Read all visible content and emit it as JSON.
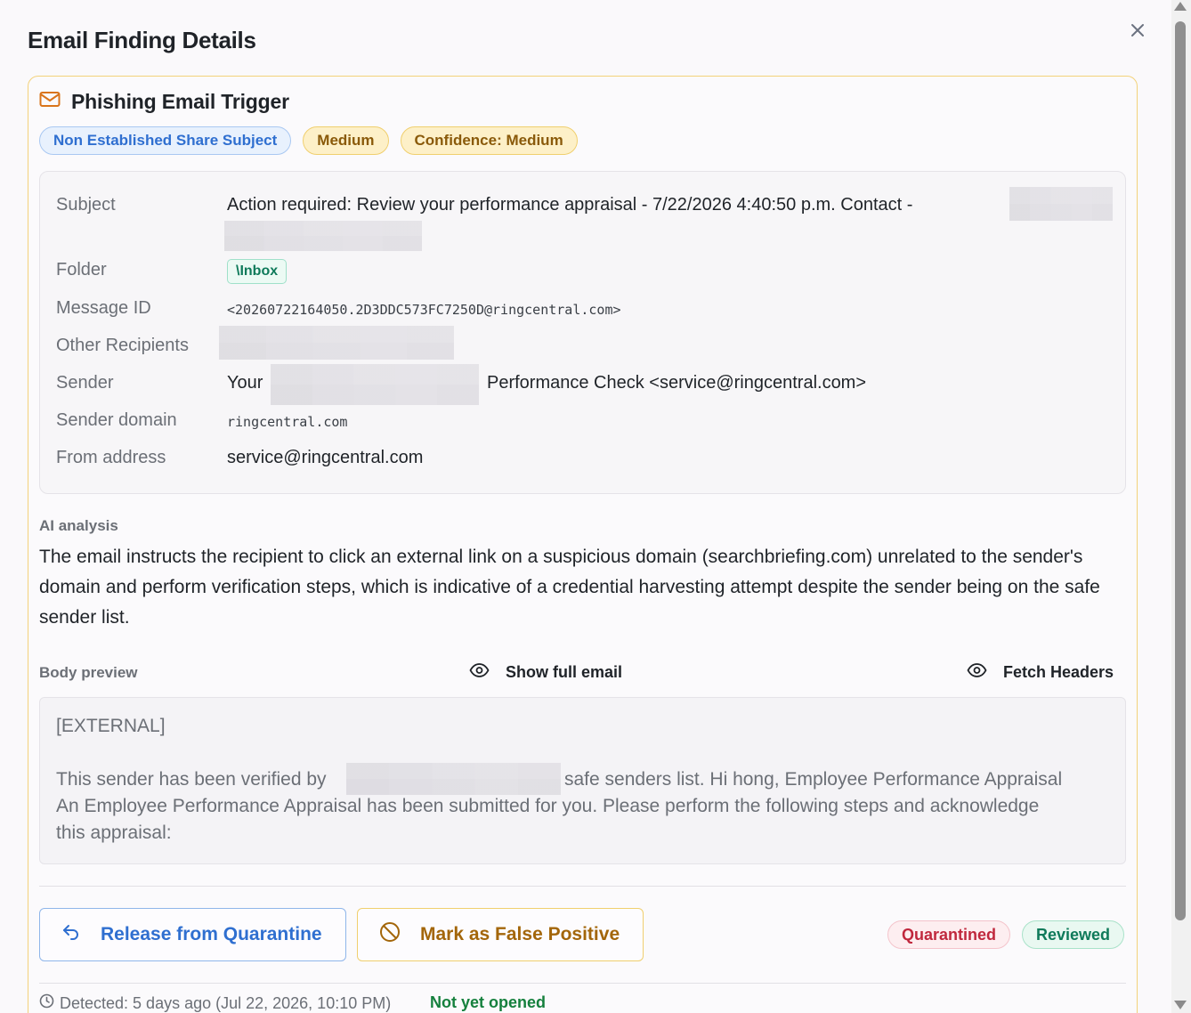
{
  "modal": {
    "title": "Email Finding Details",
    "close_icon": "close-icon"
  },
  "finding": {
    "icon": "mail-icon",
    "title": "Phishing Email Trigger",
    "badges": [
      "Non Established Share Subject",
      "Medium",
      "Confidence: Medium"
    ],
    "colors": {
      "amber": "#f3d27a",
      "blue": "#2f6fd0"
    }
  },
  "meta": {
    "subject_label": "Subject",
    "subject_value": "Action required: Review your performance appraisal - 7/22/2026 4:40:50 p.m. Contact -",
    "folder_label": "Folder",
    "folder_value": "\\Inbox",
    "message_id_label": "Message ID",
    "message_id_value": "<20260722164050.2D3DDC573FC7250D@ringcentral.com>",
    "other_recipients_label": "Other Recipients",
    "sender_label": "Sender",
    "sender_prefix": "Your",
    "sender_suffix": "Performance Check <service@ringcentral.com>",
    "sender_domain_label": "Sender domain",
    "sender_domain_value": "ringcentral.com",
    "from_label": "From address",
    "from_value": "service@ringcentral.com"
  },
  "analysis": {
    "label": "AI analysis",
    "text": "The email instructs the recipient to click an external link on a suspicious domain (searchbriefing.com) unrelated to the sender's domain and perform verification steps, which is indicative of a credential harvesting attempt despite the sender being on the safe sender list."
  },
  "body_preview": {
    "label": "Body preview",
    "show_full_label": "Show full email",
    "fetch_headers_label": "Fetch Headers",
    "line1": "[EXTERNAL]",
    "line2_prefix": "This sender has been verified by",
    "line2_suffix": "safe senders list. Hi hong, Employee Performance Appraisal",
    "line3": "An Employee Performance Appraisal has been submitted for you. Please perform the following steps and acknowledge",
    "line4": "this appraisal:"
  },
  "actions": {
    "release_label": "Release from Quarantine",
    "false_positive_label": "Mark as False Positive"
  },
  "status": {
    "quarantined": "Quarantined",
    "reviewed": "Reviewed"
  },
  "footer": {
    "detected": "Detected: 5 days ago (Jul 22, 2026, 10:10 PM)",
    "opened": "Not yet opened"
  }
}
